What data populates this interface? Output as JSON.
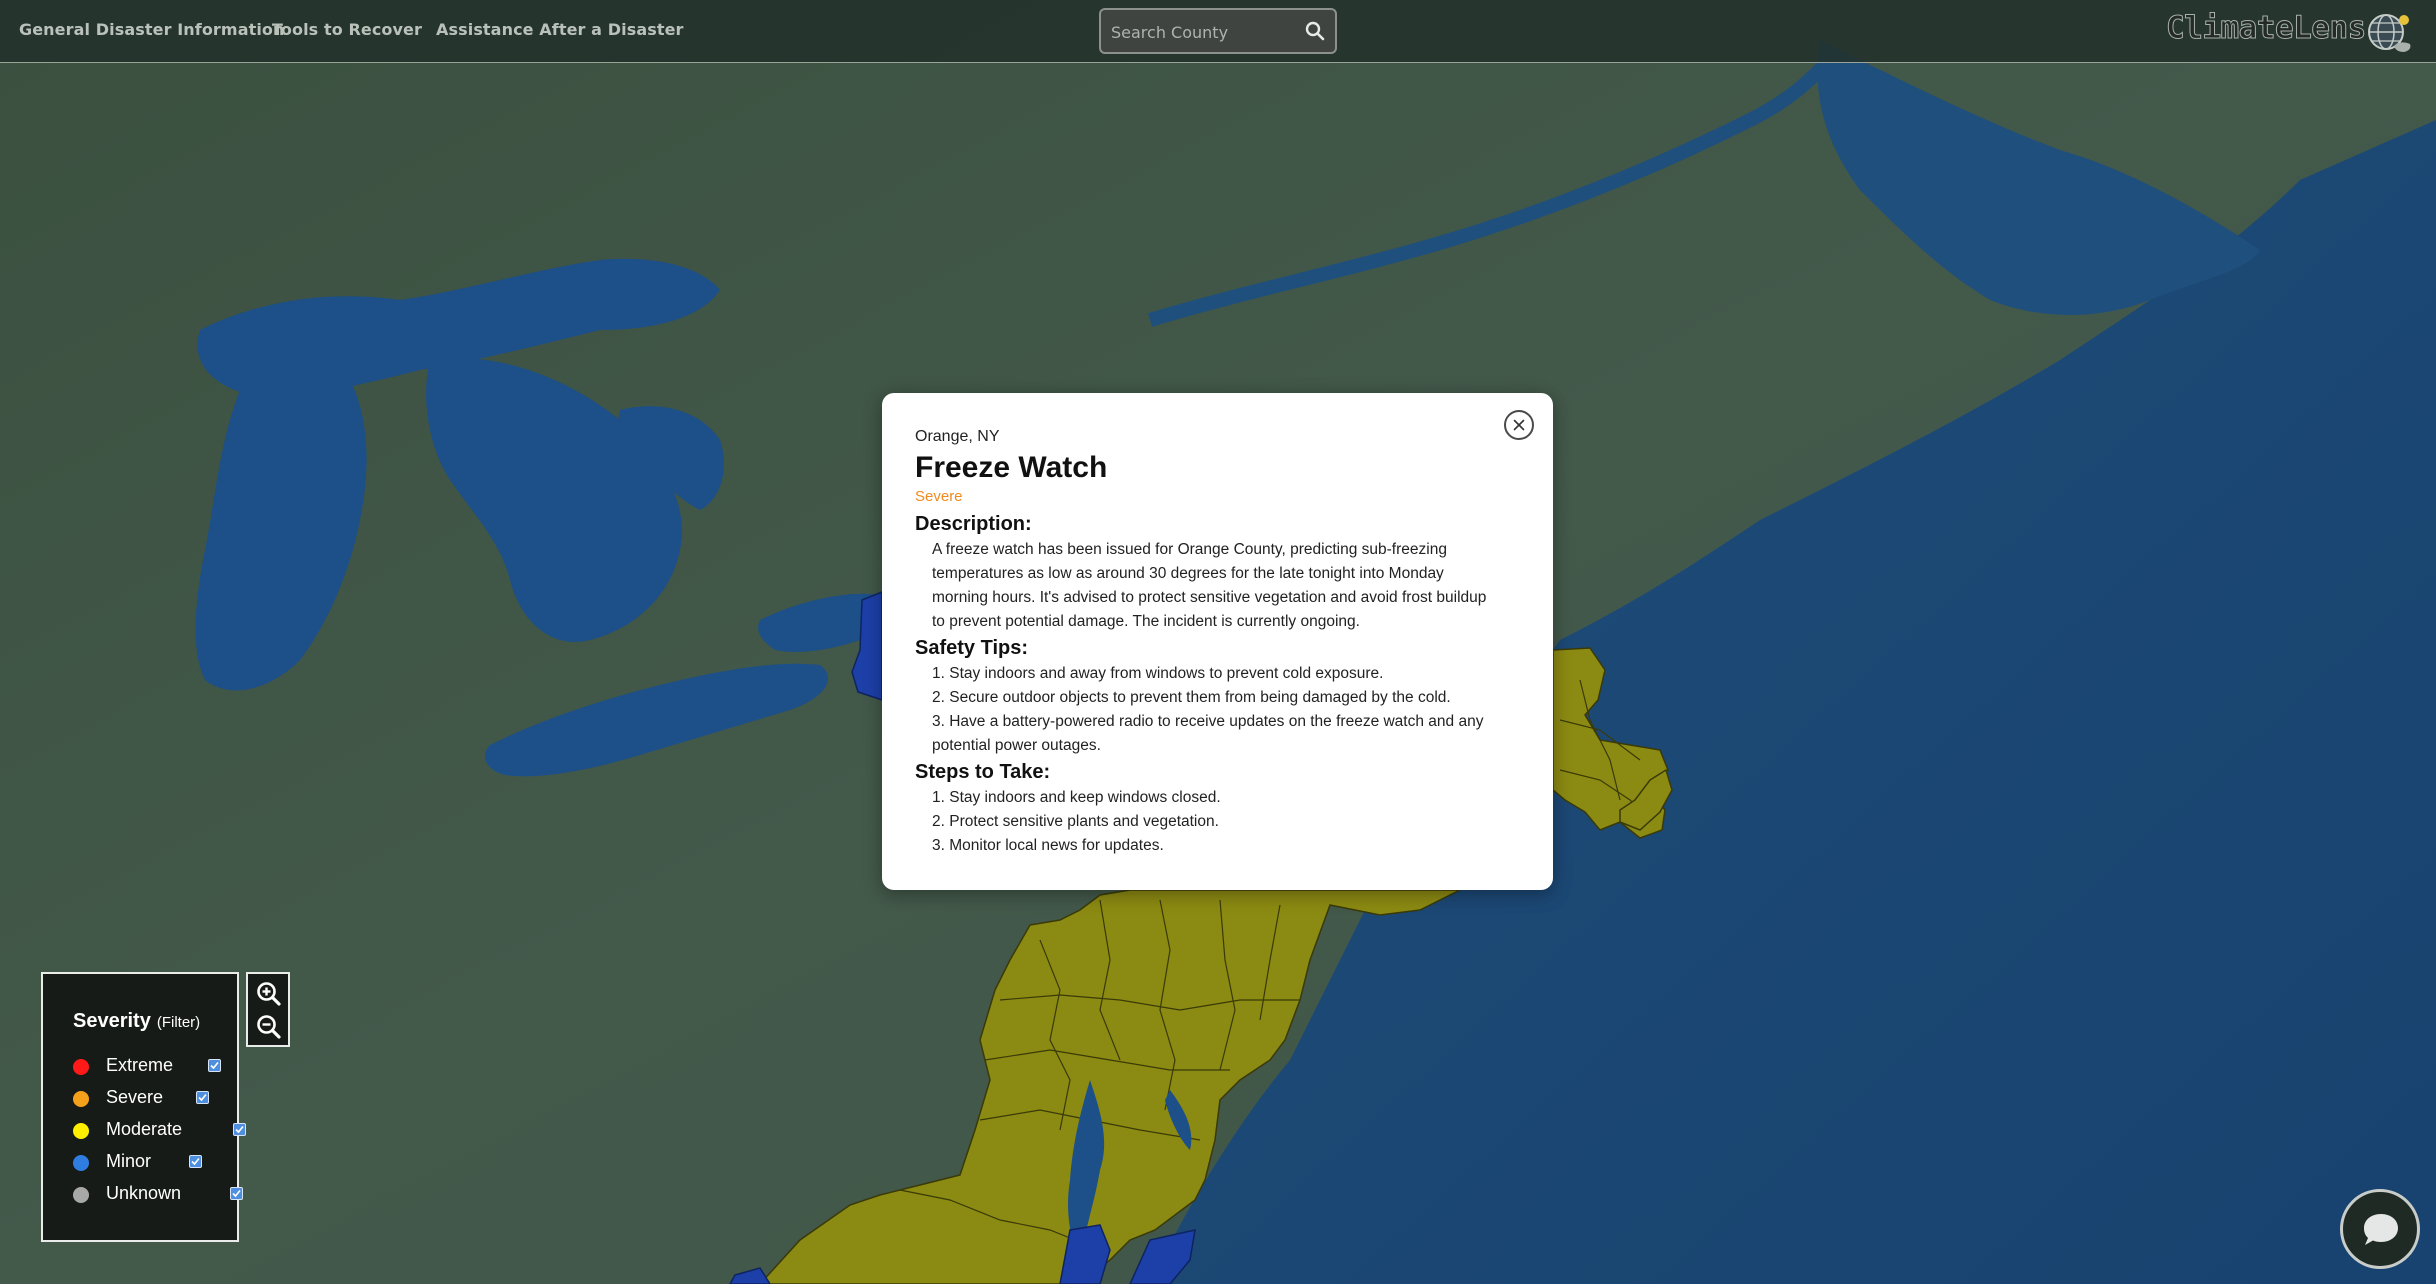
{
  "nav": {
    "links": [
      "General Disaster Information",
      "Tools to Recover",
      "Assistance After a Disaster"
    ]
  },
  "search": {
    "placeholder": "Search County",
    "icon": "search-icon"
  },
  "brand": {
    "name": "ClimateLens",
    "icon": "globe-logo-icon"
  },
  "popup": {
    "location": "Orange, NY",
    "title": "Freeze Watch",
    "severity": "Severe",
    "severity_color": "#f08a1c",
    "description_heading": "Description:",
    "description_lines": [
      "A freeze watch has been issued for Orange County, predicting sub-freezing",
      "temperatures as low as around 30 degrees for the late tonight into Monday",
      "morning hours. It's advised to protect sensitive vegetation and avoid frost buildup",
      "to prevent potential damage. The incident is currently ongoing."
    ],
    "safety_heading": "Safety Tips:",
    "safety_lines": [
      "1. Stay indoors and away from windows to prevent cold exposure.",
      "2. Secure outdoor objects to prevent them from being damaged by the cold.",
      "3. Have a battery-powered radio to receive updates on the freeze watch and any",
      "potential power outages."
    ],
    "steps_heading": "Steps to Take:",
    "steps_lines": [
      "1. Stay indoors and keep windows closed.",
      "2. Protect sensitive plants and vegetation.",
      "3. Monitor local news for updates."
    ],
    "close_icon": "close-icon"
  },
  "legend": {
    "title": "Severity",
    "subtitle": "(Filter)",
    "items": [
      {
        "label": "Extreme",
        "color": "#ff1a1a",
        "checked": true
      },
      {
        "label": "Severe",
        "color": "#f5a01a",
        "checked": true
      },
      {
        "label": "Moderate",
        "color": "#ffee00",
        "checked": true
      },
      {
        "label": "Minor",
        "color": "#2f7de1",
        "checked": true
      },
      {
        "label": "Unknown",
        "color": "#a8a8a8",
        "checked": true
      }
    ]
  },
  "zoom": {
    "in_icon": "zoom-in-icon",
    "out_icon": "zoom-out-icon"
  },
  "chat": {
    "icon": "chat-bubble-icon"
  },
  "map_colors": {
    "land": "#3c5142",
    "water": "#1b4a7a",
    "lake": "#1d4f88",
    "moderate_fill": "#8b8a12",
    "minor_fill": "#1d3fa8"
  }
}
